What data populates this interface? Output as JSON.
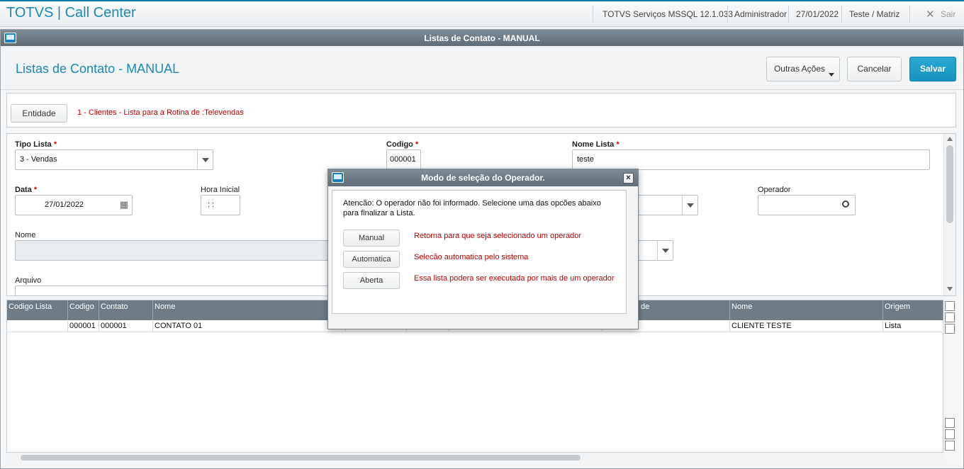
{
  "app": {
    "title": "TOTVS | Call Center"
  },
  "topbar": {
    "environment": "TOTVS Serviços MSSQL 12.1.033",
    "user": "Administrador",
    "date": "27/01/2022",
    "branch": "Teste / Matriz",
    "exit_label": "Sair"
  },
  "window": {
    "title": "Listas de Contato - MANUAL",
    "page_title": "Listas de Contato - MANUAL",
    "buttons": {
      "other_actions": "Outras Ações",
      "cancel": "Cancelar",
      "save": "Salvar"
    }
  },
  "entity": {
    "button_label": "Entidade",
    "description": "1 - Clientes - Lista para a Rotina de :Televendas"
  },
  "form": {
    "tipo_lista": {
      "label": "Tipo Lista",
      "value": "3 - Vendas"
    },
    "codigo": {
      "label": "Codigo",
      "value": "000001"
    },
    "nome_lista": {
      "label": "Nome Lista",
      "value": "teste"
    },
    "data": {
      "label": "Data",
      "value": "27/01/2022"
    },
    "hora_inicial": {
      "label": "Hora Inicial",
      "value": " : :"
    },
    "operador": {
      "label": "Operador",
      "value": ""
    },
    "nome": {
      "label": "Nome",
      "value": ""
    },
    "arquivo": {
      "label": "Arquivo",
      "value": ""
    },
    "required_mark": "*"
  },
  "grid": {
    "columns": [
      "Codigo Lista",
      "Codigo",
      "Contato",
      "Nome",
      "de",
      "Nome",
      "Origem"
    ],
    "rows": [
      {
        "codigo_lista": "",
        "codigo": "000001",
        "contato": "000001",
        "nome": "CONTATO 01",
        "nome_entidade": "CLIENTE TESTE",
        "origem": "Lista"
      }
    ]
  },
  "dialog": {
    "title": "Modo de seleção do Operador.",
    "close_label": "×",
    "message": "Atencão: O operador não foi informado. Selecione uma das opcões abaixo para finalizar a Lista.",
    "options": [
      {
        "label": "Manual",
        "description": "Retorna para que seja selecionado um operador"
      },
      {
        "label": "Automatica",
        "description": "Selecão automatica pelo sistema"
      },
      {
        "label": "Aberta",
        "description": "Essa lista podera ser executada por mais de um operador"
      }
    ]
  },
  "colors": {
    "accent": "#1a8ab8",
    "primary_button": "#1592bf",
    "alert_text": "#c00000",
    "title_bar": "#6f7c85"
  }
}
